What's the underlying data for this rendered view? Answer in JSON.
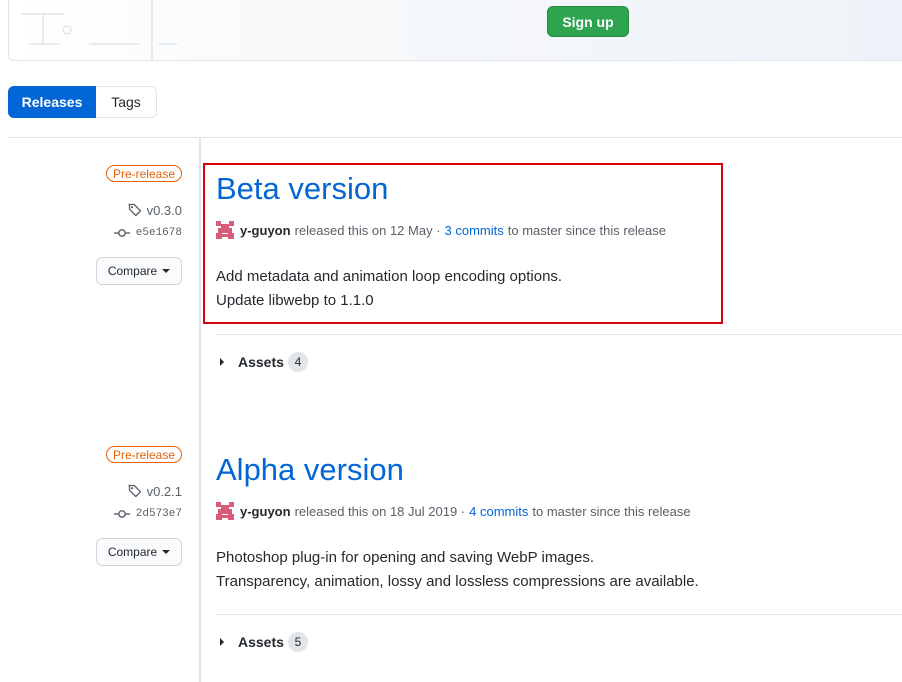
{
  "banner": {
    "signup_label": "Sign up"
  },
  "tabs": {
    "releases": "Releases",
    "tags": "Tags"
  },
  "releases": [
    {
      "badge": "Pre-release",
      "tag": "v0.3.0",
      "commit": "e5e1678",
      "compare_label": "Compare",
      "title": "Beta version",
      "author": "y-guyon",
      "released_text": "released this on 12 May ·",
      "commits_link": "3 commits",
      "since_text": "to master since this release",
      "notes": [
        "Add metadata and animation loop encoding options.",
        "Update libwebp to 1.1.0"
      ],
      "assets_label": "Assets",
      "assets_count": "4"
    },
    {
      "badge": "Pre-release",
      "tag": "v0.2.1",
      "commit": "2d573e7",
      "compare_label": "Compare",
      "title": "Alpha version",
      "author": "y-guyon",
      "released_text": "released this on 18 Jul 2019 ·",
      "commits_link": "4 commits",
      "since_text": "to master since this release",
      "notes": [
        "Photoshop plug-in for opening and saving WebP images.",
        "Transparency, animation, lossy and lossless compressions are available."
      ],
      "assets_label": "Assets",
      "assets_count": "5"
    }
  ],
  "colors": {
    "link": "#0366d6",
    "prerelease": "#e36209",
    "signup": "#2ea44f",
    "highlight": "#d7000f"
  }
}
